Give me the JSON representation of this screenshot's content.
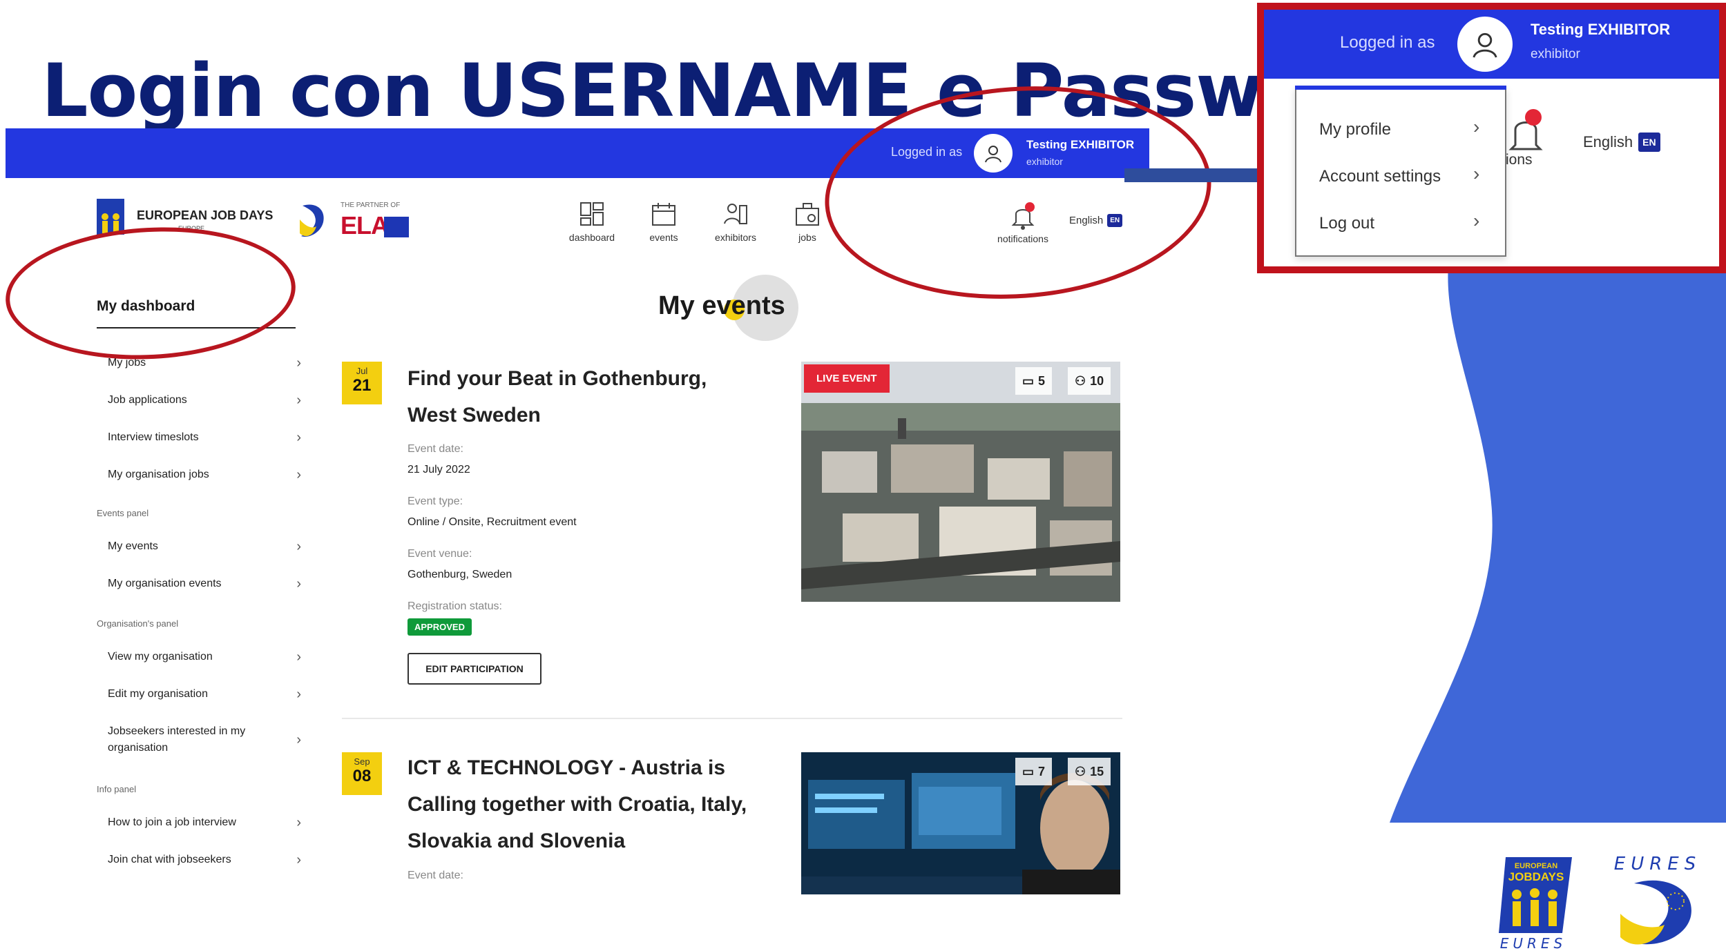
{
  "slide": {
    "title": "Login con USERNAME e Password",
    "colors": {
      "title": "#0c1f74",
      "topbar": "#2337e0",
      "callout": "#b8161f",
      "wave": "#3f67d8",
      "arrow": "#2e4d9c"
    }
  },
  "screenshot": {
    "topbar": {
      "logged_in_label": "Logged in as",
      "user_name": "Testing EXHIBITOR",
      "user_role": "exhibitor"
    },
    "brand": {
      "logo_text": "EUROPEAN JOB DAYS",
      "logo_sub": "EUROPE",
      "partner_label": "THE PARTNER OF",
      "ela": "ELA"
    },
    "nav": [
      {
        "label": "dashboard",
        "icon": "dashboard-icon"
      },
      {
        "label": "events",
        "icon": "calendar-icon"
      },
      {
        "label": "exhibitors",
        "icon": "exhibitors-icon"
      },
      {
        "label": "jobs",
        "icon": "briefcase-icon"
      }
    ],
    "notifications": {
      "label": "notifications",
      "icon": "bell-icon"
    },
    "language": {
      "label": "English",
      "code": "EN"
    },
    "sidebar": {
      "title": "My dashboard",
      "items_jobs": [
        "My jobs",
        "Job applications",
        "Interview timeslots",
        "My organisation jobs"
      ],
      "events_section": "Events panel",
      "items_events": [
        "My events",
        "My organisation events"
      ],
      "org_section": "Organisation's panel",
      "items_org": [
        "View my organisation",
        "Edit my organisation",
        "Jobseekers interested in my organisation"
      ],
      "info_section": "Info panel",
      "items_info": [
        "How to join a job interview",
        "Join chat with jobseekers"
      ]
    },
    "main": {
      "title": "My events",
      "events": [
        {
          "month": "Jul",
          "day": "21",
          "title": "Find your Beat in Gothenburg, West Sweden",
          "date_label": "Event date:",
          "date": "21 July 2022",
          "type_label": "Event type:",
          "type": "Online / Onsite, Recruitment event",
          "venue_label": "Event venue:",
          "venue": "Gothenburg, Sweden",
          "reg_label": "Registration status:",
          "status": "APPROVED",
          "edit_button": "EDIT PARTICIPATION",
          "live_badge": "LIVE EVENT",
          "employers_count": "5",
          "jobs_count": "10"
        },
        {
          "month": "Sep",
          "day": "08",
          "title": "ICT & TECHNOLOGY - Austria is Calling together with Croatia, Italy, Slovakia and Slovenia",
          "date_label": "Event date:",
          "employers_count": "7",
          "jobs_count": "15"
        }
      ]
    }
  },
  "inset": {
    "logged_in_label": "Logged in as",
    "user_name": "Testing EXHIBITOR",
    "user_role": "exhibitor",
    "menu": [
      "My profile",
      "Account settings",
      "Log out"
    ],
    "notifications_fragment": "cations",
    "language": "English",
    "language_code": "EN"
  },
  "footer": {
    "ejd_logo_top": "EUROPEAN",
    "ejd_logo_main": "JOBDAYS",
    "eures_word": "EURES"
  }
}
